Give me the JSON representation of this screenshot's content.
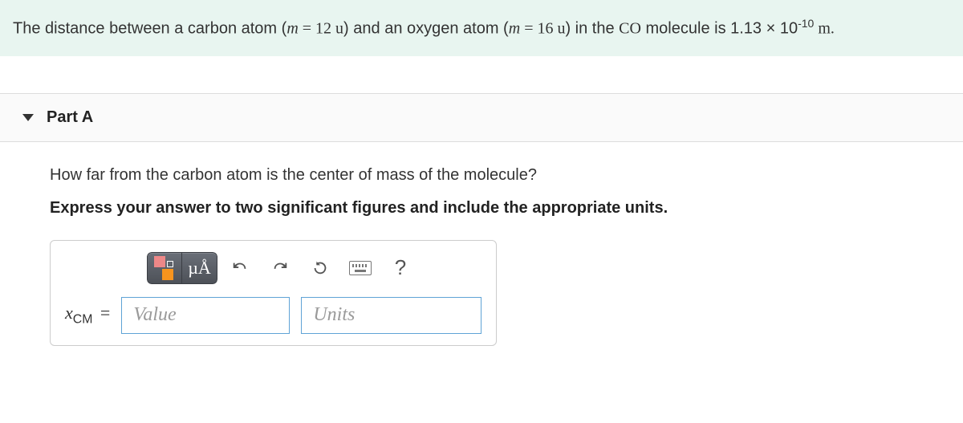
{
  "problem": {
    "pre": "The distance between a carbon atom (",
    "m1_var": "m",
    "m1_eq": " = 12 u",
    "mid1": ") and an oxygen atom (",
    "m2_var": "m",
    "m2_eq": " = 16 u",
    "mid2": ") in the ",
    "molecule": "CO",
    "mid3": " molecule is 1.13 × 10",
    "exp": "-10",
    "unit_end": " m."
  },
  "part": {
    "label": "Part A",
    "question": "How far from the carbon atom is the center of mass of the molecule?",
    "instruction": "Express your answer to two significant figures and include the appropriate units."
  },
  "toolbar": {
    "template": "fraction-template-icon",
    "mu_A": "µÅ",
    "undo": "undo-icon",
    "redo": "redo-icon",
    "reset": "reset-icon",
    "keyboard": "keyboard-icon",
    "help": "?"
  },
  "answer": {
    "lhs_var": "x",
    "lhs_sub": "CM",
    "lhs_eq": "=",
    "value_placeholder": "Value",
    "units_placeholder": "Units"
  }
}
